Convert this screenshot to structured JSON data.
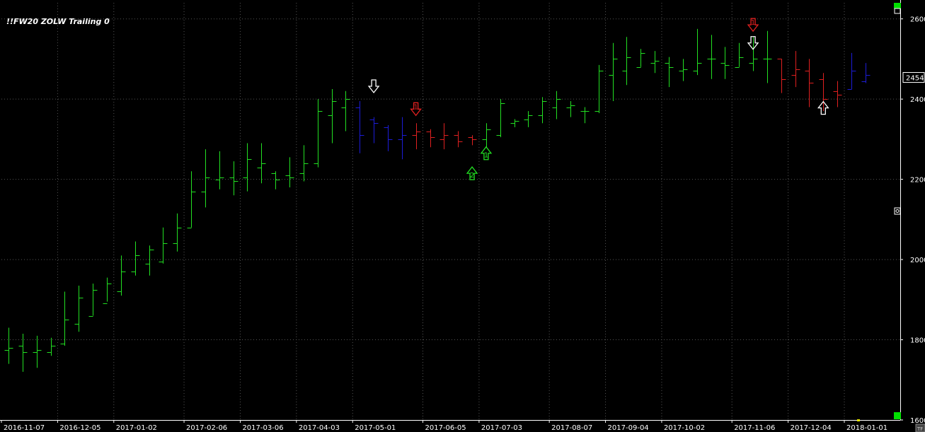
{
  "chart_data": {
    "type": "bar",
    "style": "ohlc",
    "title": "!!FW20 ZOLW Trailing 0",
    "ylim": [
      1600,
      2640
    ],
    "yticks": [
      1600,
      1800,
      2000,
      2200,
      2400,
      2600
    ],
    "last_price_label": "2454",
    "last_price": 2454,
    "x_tick_labels": [
      "2016-11-07",
      "2016-12-05",
      "2017-01-02",
      "2017-02-06",
      "2017-03-06",
      "2017-04-03",
      "2017-05-01",
      "2017-06-05",
      "2017-07-03",
      "2017-08-07",
      "2017-09-04",
      "2017-10-02",
      "2017-11-06",
      "2017-12-04",
      "2018-01-01"
    ],
    "x_tick_bar_index": [
      0,
      4,
      8,
      13,
      17,
      21,
      25,
      30,
      34,
      39,
      43,
      47,
      52,
      56,
      60
    ],
    "grid": true,
    "colors": {
      "up": "#22e022",
      "down_red": "#e02020",
      "down_blue": "#1c1cd8",
      "grid": "#555555",
      "axis": "#ffffff",
      "background": "#000000",
      "panel_indicator": "#00e000",
      "marker_yellow": "#e8e800"
    },
    "bars": [
      {
        "o": 1775,
        "h": 1830,
        "l": 1740,
        "c": 1780,
        "color": "up"
      },
      {
        "o": 1785,
        "h": 1815,
        "l": 1720,
        "c": 1770,
        "color": "up"
      },
      {
        "o": 1770,
        "h": 1810,
        "l": 1730,
        "c": 1775,
        "color": "up"
      },
      {
        "o": 1770,
        "h": 1805,
        "l": 1760,
        "c": 1785,
        "color": "up"
      },
      {
        "o": 1790,
        "h": 1920,
        "l": 1785,
        "c": 1850,
        "color": "up"
      },
      {
        "o": 1840,
        "h": 1935,
        "l": 1820,
        "c": 1905,
        "color": "up"
      },
      {
        "o": 1860,
        "h": 1940,
        "l": 1860,
        "c": 1925,
        "color": "up"
      },
      {
        "o": 1890,
        "h": 1955,
        "l": 1895,
        "c": 1940,
        "color": "up"
      },
      {
        "o": 1920,
        "h": 2010,
        "l": 1910,
        "c": 1970,
        "color": "up"
      },
      {
        "o": 1970,
        "h": 2045,
        "l": 1960,
        "c": 2010,
        "color": "up"
      },
      {
        "o": 1990,
        "h": 2035,
        "l": 1960,
        "c": 2025,
        "color": "up"
      },
      {
        "o": 1995,
        "h": 2080,
        "l": 1990,
        "c": 2040,
        "color": "up"
      },
      {
        "o": 2040,
        "h": 2115,
        "l": 2020,
        "c": 2080,
        "color": "up"
      },
      {
        "o": 2080,
        "h": 2220,
        "l": 2080,
        "c": 2170,
        "color": "up"
      },
      {
        "o": 2170,
        "h": 2275,
        "l": 2130,
        "c": 2205,
        "color": "up"
      },
      {
        "o": 2200,
        "h": 2270,
        "l": 2175,
        "c": 2205,
        "color": "up"
      },
      {
        "o": 2205,
        "h": 2245,
        "l": 2160,
        "c": 2195,
        "color": "up"
      },
      {
        "o": 2205,
        "h": 2290,
        "l": 2170,
        "c": 2250,
        "color": "up"
      },
      {
        "o": 2230,
        "h": 2290,
        "l": 2190,
        "c": 2240,
        "color": "up"
      },
      {
        "o": 2215,
        "h": 2220,
        "l": 2175,
        "c": 2200,
        "color": "up"
      },
      {
        "o": 2210,
        "h": 2255,
        "l": 2180,
        "c": 2205,
        "color": "up"
      },
      {
        "o": 2215,
        "h": 2285,
        "l": 2195,
        "c": 2240,
        "color": "up"
      },
      {
        "o": 2240,
        "h": 2400,
        "l": 2230,
        "c": 2370,
        "color": "up"
      },
      {
        "o": 2360,
        "h": 2425,
        "l": 2290,
        "c": 2395,
        "color": "up"
      },
      {
        "o": 2380,
        "h": 2420,
        "l": 2320,
        "c": 2400,
        "color": "up"
      },
      {
        "o": 2380,
        "h": 2395,
        "l": 2265,
        "c": 2310,
        "color": "blue"
      },
      {
        "o": 2350,
        "h": 2355,
        "l": 2290,
        "c": 2340,
        "color": "blue"
      },
      {
        "o": 2330,
        "h": 2335,
        "l": 2270,
        "c": 2300,
        "color": "blue"
      },
      {
        "o": 2300,
        "h": 2355,
        "l": 2250,
        "c": 2310,
        "color": "blue"
      },
      {
        "o": 2310,
        "h": 2340,
        "l": 2275,
        "c": 2320,
        "color": "red"
      },
      {
        "o": 2320,
        "h": 2325,
        "l": 2280,
        "c": 2305,
        "color": "red"
      },
      {
        "o": 2300,
        "h": 2340,
        "l": 2275,
        "c": 2310,
        "color": "red"
      },
      {
        "o": 2310,
        "h": 2320,
        "l": 2280,
        "c": 2295,
        "color": "red"
      },
      {
        "o": 2305,
        "h": 2310,
        "l": 2285,
        "c": 2300,
        "color": "red"
      },
      {
        "o": 2300,
        "h": 2340,
        "l": 2280,
        "c": 2325,
        "color": "up"
      },
      {
        "o": 2310,
        "h": 2400,
        "l": 2305,
        "c": 2390,
        "color": "up"
      },
      {
        "o": 2340,
        "h": 2350,
        "l": 2330,
        "c": 2345,
        "color": "up"
      },
      {
        "o": 2350,
        "h": 2370,
        "l": 2330,
        "c": 2360,
        "color": "up"
      },
      {
        "o": 2360,
        "h": 2405,
        "l": 2340,
        "c": 2395,
        "color": "up"
      },
      {
        "o": 2380,
        "h": 2420,
        "l": 2350,
        "c": 2400,
        "color": "up"
      },
      {
        "o": 2380,
        "h": 2395,
        "l": 2355,
        "c": 2385,
        "color": "up"
      },
      {
        "o": 2370,
        "h": 2380,
        "l": 2340,
        "c": 2370,
        "color": "up"
      },
      {
        "o": 2370,
        "h": 2485,
        "l": 2365,
        "c": 2470,
        "color": "up"
      },
      {
        "o": 2460,
        "h": 2540,
        "l": 2395,
        "c": 2500,
        "color": "up"
      },
      {
        "o": 2470,
        "h": 2555,
        "l": 2435,
        "c": 2505,
        "color": "up"
      },
      {
        "o": 2480,
        "h": 2525,
        "l": 2480,
        "c": 2515,
        "color": "up"
      },
      {
        "o": 2490,
        "h": 2520,
        "l": 2465,
        "c": 2495,
        "color": "up"
      },
      {
        "o": 2490,
        "h": 2505,
        "l": 2430,
        "c": 2480,
        "color": "up"
      },
      {
        "o": 2470,
        "h": 2500,
        "l": 2445,
        "c": 2475,
        "color": "up"
      },
      {
        "o": 2470,
        "h": 2575,
        "l": 2460,
        "c": 2490,
        "color": "up"
      },
      {
        "o": 2500,
        "h": 2560,
        "l": 2450,
        "c": 2500,
        "color": "up"
      },
      {
        "o": 2490,
        "h": 2530,
        "l": 2450,
        "c": 2485,
        "color": "up"
      },
      {
        "o": 2480,
        "h": 2540,
        "l": 2480,
        "c": 2505,
        "color": "up"
      },
      {
        "o": 2490,
        "h": 2555,
        "l": 2470,
        "c": 2500,
        "color": "up"
      },
      {
        "o": 2500,
        "h": 2570,
        "l": 2440,
        "c": 2500,
        "color": "up"
      },
      {
        "o": 2500,
        "h": 2500,
        "l": 2415,
        "c": 2450,
        "color": "red"
      },
      {
        "o": 2460,
        "h": 2520,
        "l": 2430,
        "c": 2475,
        "color": "red"
      },
      {
        "o": 2470,
        "h": 2500,
        "l": 2380,
        "c": 2440,
        "color": "red"
      },
      {
        "o": 2450,
        "h": 2465,
        "l": 2370,
        "c": 2400,
        "color": "red"
      },
      {
        "o": 2420,
        "h": 2445,
        "l": 2380,
        "c": 2410,
        "color": "red"
      },
      {
        "o": 2425,
        "h": 2515,
        "l": 2425,
        "c": 2470,
        "color": "blue"
      },
      {
        "o": 2445,
        "h": 2490,
        "l": 2440,
        "c": 2460,
        "color": "blue"
      }
    ],
    "annotations": [
      {
        "bar": 26,
        "price": 2432,
        "dir": "down",
        "label": "",
        "color": "#ffffff"
      },
      {
        "bar": 29,
        "price": 2375,
        "dir": "down",
        "label": "1",
        "color": "#e02020"
      },
      {
        "bar": 33,
        "price": 2215,
        "dir": "up",
        "label": "2",
        "color": "#22e022"
      },
      {
        "bar": 34,
        "price": 2265,
        "dir": "up",
        "label": "1",
        "color": "#22e022"
      },
      {
        "bar": 53,
        "price": 2585,
        "dir": "down",
        "label": "1",
        "color": "#e02020"
      },
      {
        "bar": 53,
        "price": 2540,
        "dir": "down",
        "label": "",
        "color": "#ffffff"
      },
      {
        "bar": 58,
        "price": 2378,
        "dir": "up",
        "label": "",
        "color": "#ffffff"
      }
    ],
    "corner_label": "TF"
  }
}
